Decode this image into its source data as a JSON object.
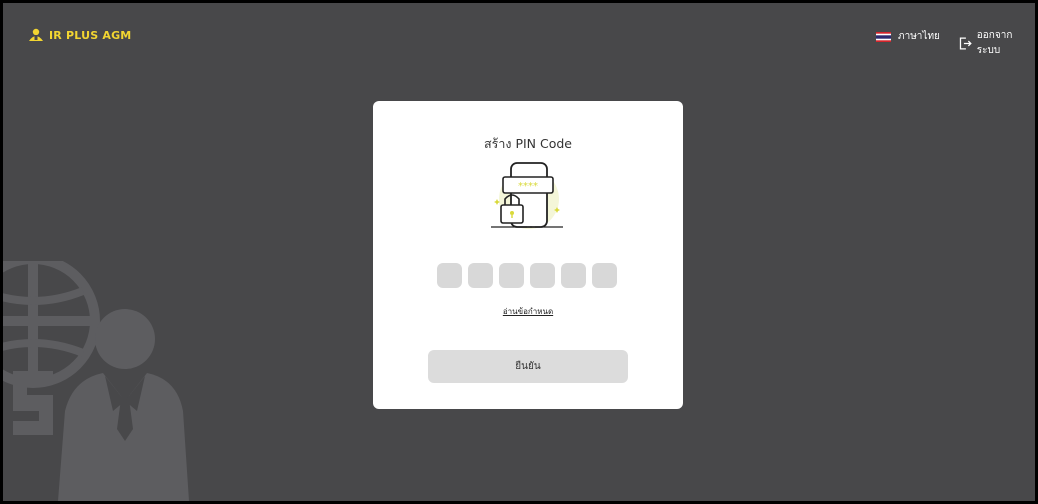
{
  "header": {
    "brand": "IR PLUS AGM",
    "language_label": "ภาษาไทย",
    "logout_label": "ออกจากระบบ"
  },
  "card": {
    "title": "สร้าง PIN Code",
    "pin_length": 6,
    "terms_link": "อ่านข้อกำหนด",
    "confirm_button": "ยืนยัน"
  },
  "colors": {
    "background": "#48484a",
    "brand_yellow": "#f2d531",
    "card": "#ffffff",
    "pin_box": "#d8d8d8",
    "button": "#dcdcdc"
  },
  "icons": [
    "brand-logo-icon",
    "thai-flag-icon",
    "logout-icon",
    "pin-phone-lock-illustration",
    "globe-businessman-illustration"
  ]
}
